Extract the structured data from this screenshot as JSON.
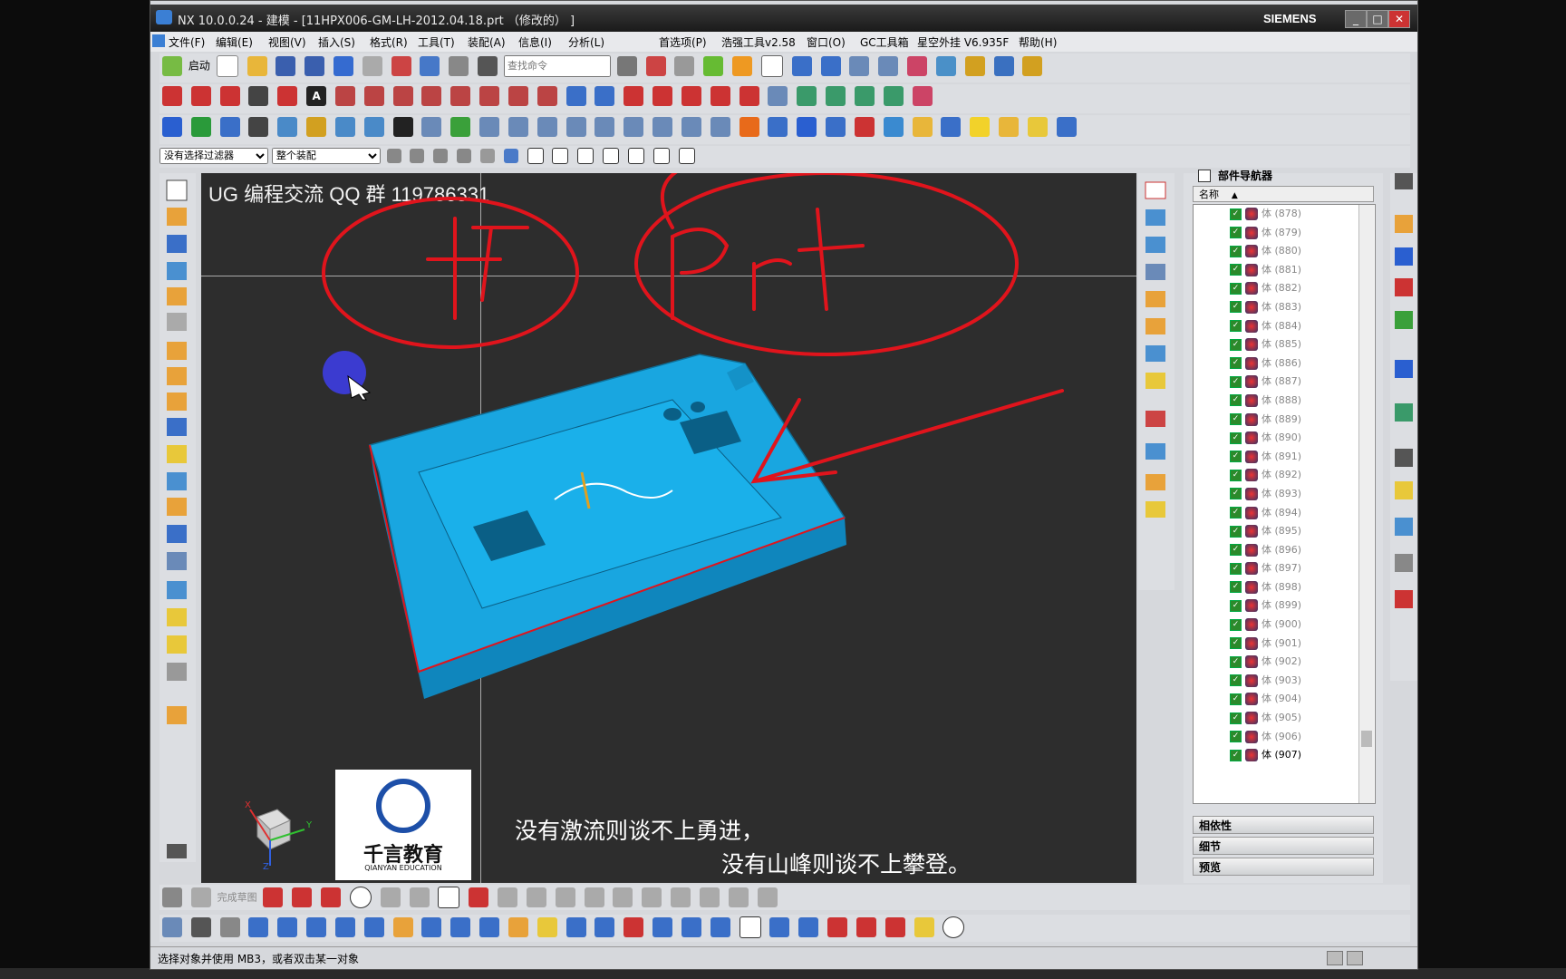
{
  "window": {
    "title": "NX 10.0.0.24 - 建模 - [11HPX006-GM-LH-2012.04.18.prt （修改的） ]",
    "brand": "SIEMENS",
    "min": "_",
    "max": "□",
    "close": "✕"
  },
  "menu": [
    "文件(F)",
    "编辑(E)",
    "视图(V)",
    "插入(S)",
    "格式(R)",
    "工具(T)",
    "装配(A)",
    "信息(I)",
    "分析(L)",
    "首选项(P)",
    "浩强工具v2.58",
    "窗口(O)",
    "GC工具箱",
    "星空外挂 V6.935F",
    "帮助(H)"
  ],
  "toolbar": {
    "start_label": "启动",
    "search_placeholder": "查找命令",
    "filter_value": "没有选择过滤器",
    "scope_value": "整个装配",
    "sketch_finish": "完成草图"
  },
  "viewport": {
    "watermark": "UG 编程交流 QQ 群 119786331",
    "handwriting": "打开 prt",
    "quote_line1": "没有激流则谈不上勇进，",
    "quote_line2": "没有山峰则谈不上攀登。",
    "logo_cn": "千言教育",
    "logo_en": "QIANYAN EDUCATION",
    "axis_x": "X",
    "axis_y": "Y",
    "axis_z": "Z"
  },
  "navigator": {
    "title": "部件导航器",
    "col_name": "名称",
    "rows": [
      "体 (878)",
      "体 (879)",
      "体 (880)",
      "体 (881)",
      "体 (882)",
      "体 (883)",
      "体 (884)",
      "体 (885)",
      "体 (886)",
      "体 (887)",
      "体 (888)",
      "体 (889)",
      "体 (890)",
      "体 (891)",
      "体 (892)",
      "体 (893)",
      "体 (894)",
      "体 (895)",
      "体 (896)",
      "体 (897)",
      "体 (898)",
      "体 (899)",
      "体 (900)",
      "体 (901)",
      "体 (902)",
      "体 (903)",
      "体 (904)",
      "体 (905)",
      "体 (906)",
      "体 (907)"
    ],
    "panels": [
      "相依性",
      "细节",
      "预览"
    ]
  },
  "status": "选择对象并使用 MB3，或者双击某一对象",
  "colors": {
    "part": "#19a6e0",
    "annotation": "#e0141c",
    "viewport": "#2d2d2d"
  }
}
